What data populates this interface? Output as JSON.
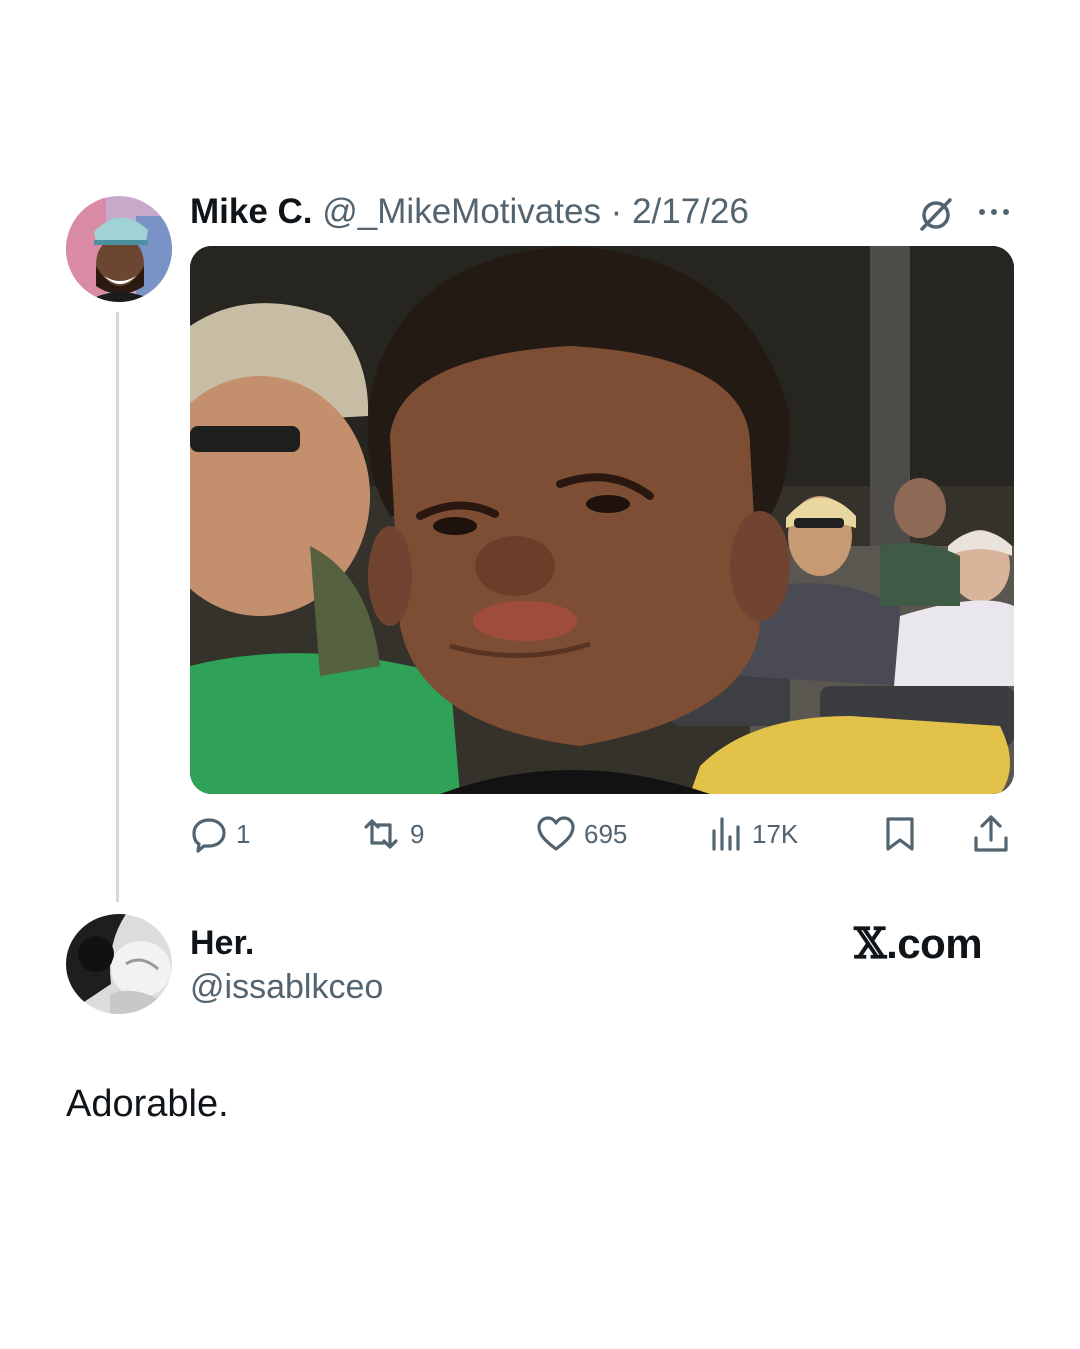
{
  "tweet": {
    "author_name": "Mike C.",
    "author_handle": "@_MikeMotivates",
    "separator": " · ",
    "date": "2/17/26",
    "avatar_icon": "avatar-photo",
    "media_description_icon": "photo-media",
    "actions": {
      "reply_count": "1",
      "retweet_count": "9",
      "like_count": "695",
      "views_count": "17K"
    }
  },
  "reply": {
    "author_name": "Her.",
    "author_handle": "@issablkceo",
    "text": "Adorable.",
    "avatar_icon": "avatar-photo"
  },
  "brand": {
    "x_glyph": "𝕏",
    "suffix": ".com"
  },
  "colors": {
    "text": "#0f1419",
    "secondary": "#536471",
    "thread_line": "#cfd9de"
  }
}
